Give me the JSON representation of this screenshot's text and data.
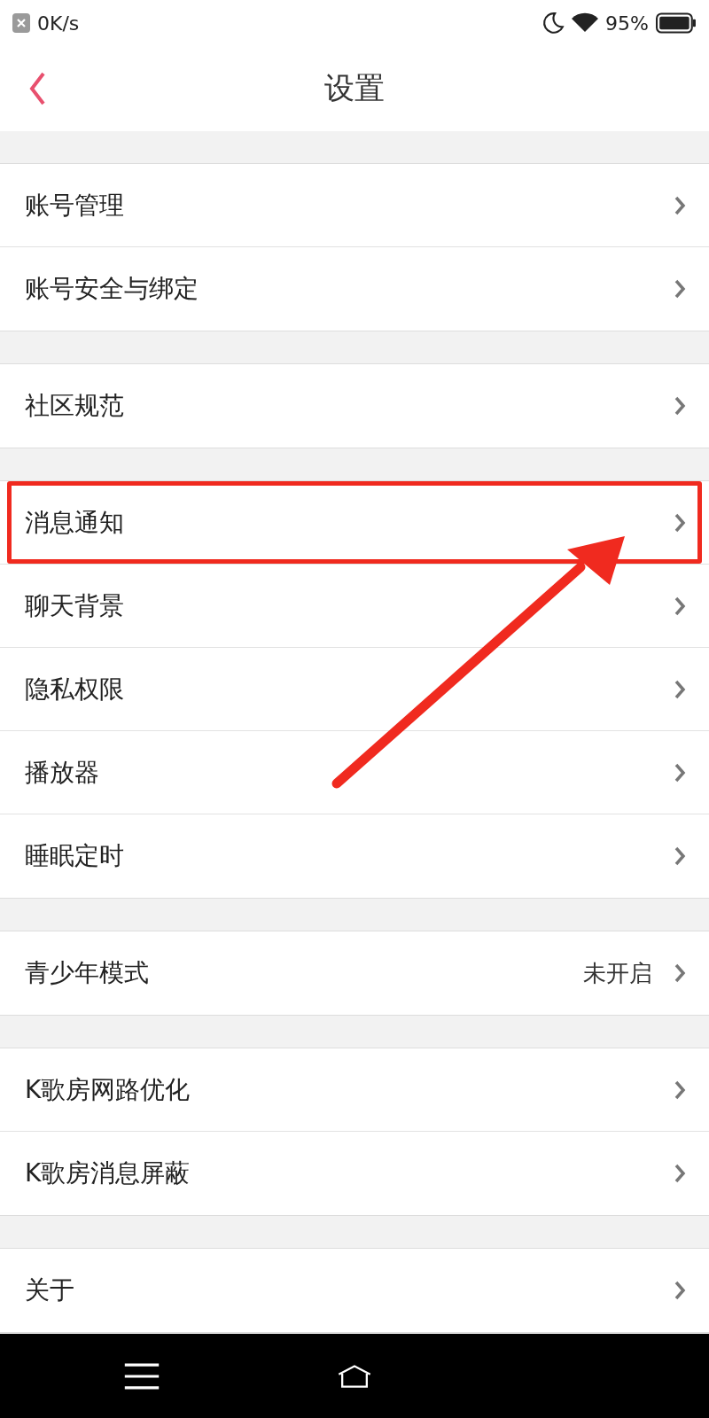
{
  "status_bar": {
    "speed": "0K/s",
    "battery": "95%"
  },
  "header": {
    "title": "设置"
  },
  "groups": [
    {
      "items": [
        {
          "label": "账号管理",
          "highlighted": false
        },
        {
          "label": "账号安全与绑定",
          "highlighted": false
        }
      ]
    },
    {
      "items": [
        {
          "label": "社区规范",
          "highlighted": false
        }
      ]
    },
    {
      "items": [
        {
          "label": "消息通知",
          "highlighted": true
        },
        {
          "label": "聊天背景",
          "highlighted": false
        },
        {
          "label": "隐私权限",
          "highlighted": false
        },
        {
          "label": "播放器",
          "highlighted": false
        },
        {
          "label": "睡眠定时",
          "highlighted": false
        }
      ]
    },
    {
      "items": [
        {
          "label": "青少年模式",
          "value": "未开启",
          "highlighted": false
        }
      ]
    },
    {
      "items": [
        {
          "label": "K歌房网路优化",
          "highlighted": false
        },
        {
          "label": "K歌房消息屏蔽",
          "highlighted": false
        }
      ]
    },
    {
      "items": [
        {
          "label": "关于",
          "highlighted": false
        }
      ]
    }
  ],
  "annotation": {
    "arrow": true
  }
}
